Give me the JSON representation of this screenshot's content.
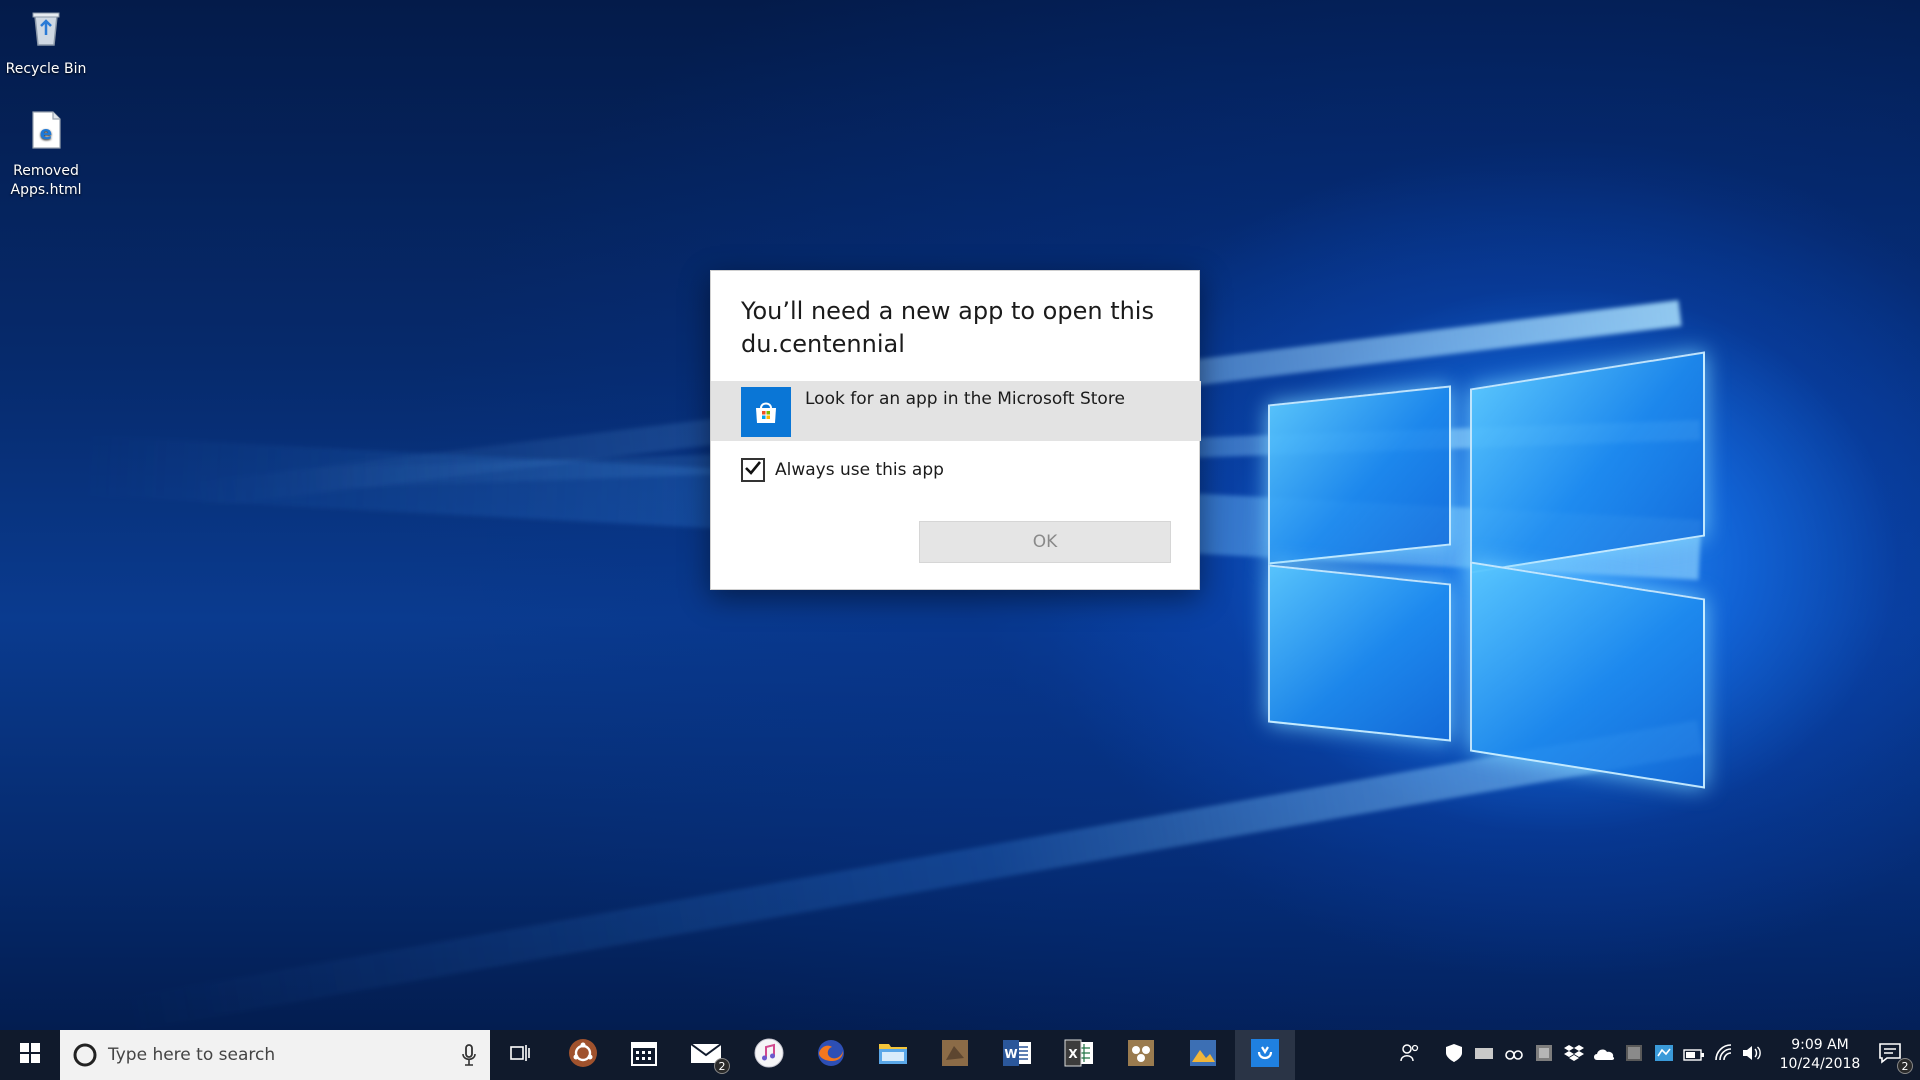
{
  "desktop": {
    "icons": [
      {
        "label": "Recycle Bin",
        "icon": "recycle-bin-icon"
      },
      {
        "label": "Removed Apps.html",
        "icon": "edge-html-file-icon"
      }
    ]
  },
  "dialog": {
    "title": "You’ll need a new app to open this du.centennial",
    "store_option": {
      "label": "Look for an app in the Microsoft Store",
      "icon": "microsoft-store-icon"
    },
    "always_use": {
      "label": "Always use this app",
      "checked": true
    },
    "ok_label": "OK"
  },
  "taskbar": {
    "search_placeholder": "Type here to search",
    "pinned_apps": [
      {
        "icon": "task-view-icon"
      },
      {
        "icon": "ubuntu-icon"
      },
      {
        "icon": "calendar-icon"
      },
      {
        "icon": "mail-icon",
        "badge": "2"
      },
      {
        "icon": "itunes-icon"
      },
      {
        "icon": "firefox-icon"
      },
      {
        "icon": "file-explorer-icon"
      },
      {
        "icon": "app-icon"
      },
      {
        "icon": "word-icon"
      },
      {
        "icon": "excel-icon"
      },
      {
        "icon": "app-icon"
      },
      {
        "icon": "photos-icon"
      },
      {
        "icon": "app-icon"
      }
    ],
    "tray_icons": [
      "people-icon",
      "defender-icon",
      "app-icon",
      "app-icon",
      "app-icon",
      "dropbox-icon",
      "onedrive-icon",
      "app-icon",
      "app-icon",
      "battery-icon",
      "wifi-icon",
      "volume-icon"
    ],
    "clock": {
      "time": "9:09 AM",
      "date": "10/24/2018"
    },
    "notifications_badge": "2"
  },
  "colors": {
    "taskbar_bg": "#101a2c",
    "accent": "#0a76d6",
    "dialog_bg": "#ffffff"
  }
}
